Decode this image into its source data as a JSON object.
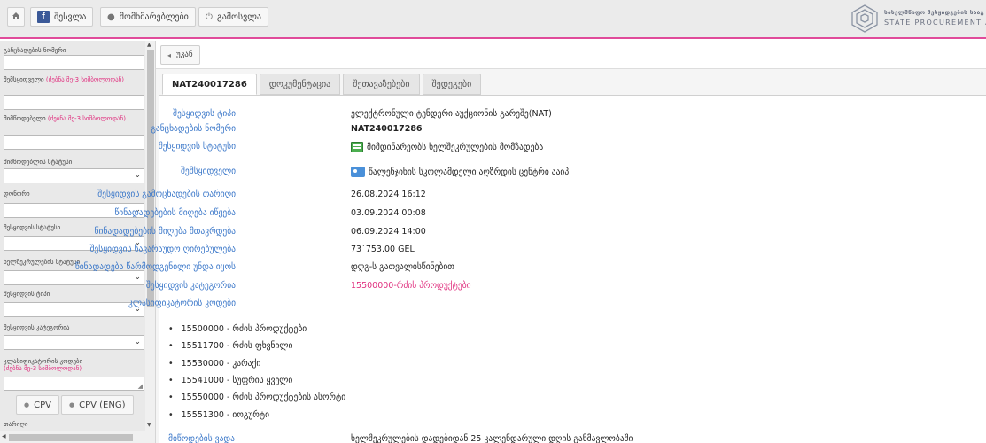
{
  "header": {
    "home_icon": "home-icon",
    "login_label": "შესვლა",
    "users_label": "მომხმარებლები",
    "logout_label": "გამოსვლა",
    "logo_line1": "სახელმწიფო შესყიდვების სააგ",
    "logo_line2": "STATE PROCUREMENT AGE"
  },
  "sidebar": {
    "fields": [
      {
        "label": "განცხადების ნომერი",
        "type": "input",
        "value": ""
      },
      {
        "label": "შემსყიდველი",
        "hint": "(ძებნა მე-3 სიმბოლოდან)",
        "type": "input",
        "value": ""
      },
      {
        "label": "მიმწოდებელი",
        "hint": "(ძებნა მე-3 სიმბოლოდან)",
        "type": "input",
        "value": ""
      },
      {
        "label": "მიმწოდებლის სტატუსი",
        "type": "select",
        "value": ""
      },
      {
        "label": "დონორი",
        "type": "select",
        "value": ""
      },
      {
        "label": "შესყიდვის სტატუსი",
        "type": "select",
        "value": ""
      },
      {
        "label": "ხელშეკრულების სტატუსი",
        "type": "select",
        "value": ""
      },
      {
        "label": "შესყიდვის ტიპი",
        "type": "select",
        "value": ""
      },
      {
        "label": "შესყიდვის კატეგორია",
        "type": "select",
        "value": ""
      },
      {
        "label": "კლასიფიკატორის კოდები",
        "hint": "(ძებნა მე-3 სიმბოლოდან)",
        "type": "textarea",
        "value": ""
      }
    ],
    "cpv_label": "CPV",
    "cpv_eng_label": "CPV (ENG)",
    "date_label": "თარიღი"
  },
  "main": {
    "back_label": "უკან",
    "tabs": [
      "NAT240017286",
      "დოკუმენტაცია",
      "შეთავაზებები",
      "შედეგები"
    ],
    "details": [
      {
        "label": "შესყიდვის ტიპი",
        "value": "ელექტრონული ტენდერი აუქციონის გარეშე(NAT)",
        "style": ""
      },
      {
        "label": "განცხადების ნომერი",
        "value": "NAT240017286",
        "style": "bold"
      },
      {
        "label": "შესყიდვის სტატუსი",
        "value": "მიმდინარეობს ხელშეკრულების მომზადება",
        "style": "",
        "icon": "status-icon"
      },
      {
        "label": "შემსყიდველი",
        "value": "წალენჯიხის სკოლამდელი აღზრდის ცენტრი ააიპ",
        "style": "",
        "icon": "organization-icon"
      },
      {
        "label": "შესყიდვის გამოცხადების თარიღი",
        "value": "26.08.2024 16:12",
        "style": ""
      },
      {
        "label": "წინადადებების მიღება იწყება",
        "value": "03.09.2024 00:08",
        "style": ""
      },
      {
        "label": "წინადადებების მიღება მთავრდება",
        "value": "06.09.2024 14:00",
        "style": ""
      },
      {
        "label": "შესყიდვის სავარაუდო ღირებულება",
        "value": "73`753.00 GEL",
        "style": ""
      },
      {
        "label": "წინადადება წარმოდგენილი უნდა იყოს",
        "value": "დღგ-ს გათვალისწინებით",
        "style": ""
      },
      {
        "label": "შესყიდვის კატეგორია",
        "value": "15500000-რძის პროდუქტები",
        "style": "pink"
      },
      {
        "label": "კლასიფიკატორის კოდები",
        "value": "",
        "style": ""
      }
    ],
    "cpv_codes": [
      "15500000 - რძის პროდუქტები",
      "15511700 - რძის ფხვნილი",
      "15530000 - კარაქი",
      "15541000 - სუფრის ყველი",
      "15550000 - რძის პროდუქტების ასორტი",
      "15551300 - იოგურტი"
    ],
    "bottom_label": "მიწოდების ვადა",
    "bottom_value": "ხელშეკრულების დადებიდან 25 კალენდარული დღის განმავლობაში"
  }
}
